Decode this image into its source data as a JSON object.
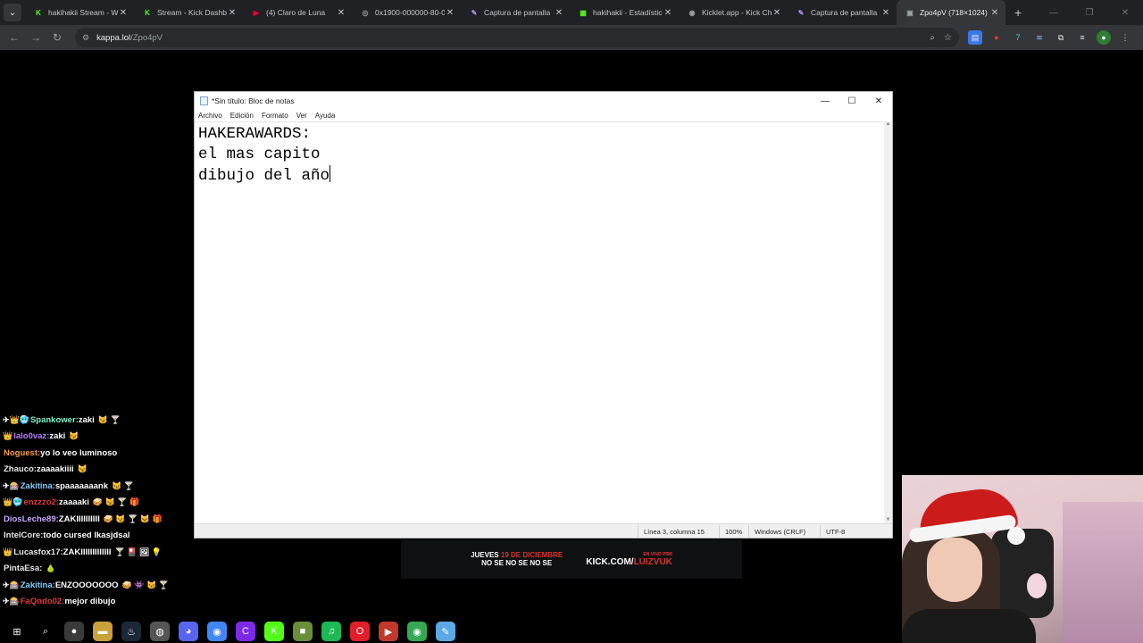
{
  "browser": {
    "tabs": [
      {
        "title": "hakihakii Stream - W",
        "favicon": "kick-icon",
        "color": "#53fc18",
        "glyph": "K"
      },
      {
        "title": "Stream - Kick Dashbo",
        "favicon": "kick-icon",
        "color": "#53fc18",
        "glyph": "K"
      },
      {
        "title": "(4) Claro de Luna",
        "favicon": "youtube-icon",
        "color": "#ff0033",
        "glyph": "▶"
      },
      {
        "title": "0x1900-000000-80-0",
        "favicon": "globe-icon",
        "color": "#9aa0a6",
        "glyph": "◎"
      },
      {
        "title": "Captura de pantalla",
        "favicon": "pen-icon",
        "color": "#b58cff",
        "glyph": "✎"
      },
      {
        "title": "hakihakii - Estadístic",
        "favicon": "stats-icon",
        "color": "#53fc18",
        "glyph": "▦"
      },
      {
        "title": "Kicklet.app - Kick Ch",
        "favicon": "kicklet-icon",
        "color": "#9aa0a6",
        "glyph": "◉"
      },
      {
        "title": "Captura de pantalla",
        "favicon": "pen-icon",
        "color": "#b58cff",
        "glyph": "✎"
      },
      {
        "title": "Zpo4pV (718×1024)",
        "favicon": "image-icon",
        "color": "#9aa0a6",
        "glyph": "▣",
        "active": true
      }
    ],
    "new_tab": "+",
    "url_host": "kappa.lol",
    "url_path": "/Zpo4pV"
  },
  "notepad": {
    "title": "*Sin título: Bloc de notas",
    "menu": [
      "Archivo",
      "Edición",
      "Formato",
      "Ver",
      "Ayuda"
    ],
    "lines": [
      "HAKERAWARDS:",
      "el mas capito",
      "dibujo del año"
    ],
    "status": {
      "position": "Línea 3, columna 15",
      "zoom": "100%",
      "line_ending": "Windows (CRLF)",
      "encoding": "UTF-8"
    }
  },
  "banner": {
    "line1_a": "JUEVES",
    "line1_b": "19 DE DICIEMBRE",
    "line2": "NO SE NO SE NO SE",
    "tag": "EN VIVO POR",
    "link_a": "KICK.COM/",
    "link_b": "LUIZVUK"
  },
  "chat": [
    {
      "badges": "✈👑🥶",
      "user": "Spankower",
      "color": "#7ff0c9",
      "msg": "zaki",
      "emotes": "😼 🍸"
    },
    {
      "badges": "👑",
      "user": "lalo0vaz",
      "color": "#b57cff",
      "msg": "zaki",
      "emotes": "😼"
    },
    {
      "badges": "",
      "user": "Noguest",
      "color": "#ff9b3d",
      "msg": "yo lo veo luminoso",
      "emotes": ""
    },
    {
      "badges": "",
      "user": "Zhauco",
      "color": "#e8e8e8",
      "msg": "zaaaakiiii",
      "emotes": "😼"
    },
    {
      "badges": "✈🎰",
      "user": "Zakitina",
      "color": "#7fd0ff",
      "msg": "spaaaaaaank",
      "emotes": "😼 🍸"
    },
    {
      "badges": "👑🥶",
      "user": "enzzzo2",
      "color": "#e23b3b",
      "msg": "zaaaaki",
      "emotes": "🥪 😼 🍸 🎁"
    },
    {
      "badges": "",
      "user": "DiosLeche89",
      "color": "#c9a7ff",
      "msg": "ZAKIIIIIIIIII",
      "emotes": "🥪 😼 🍸 🐱 🎁"
    },
    {
      "badges": "",
      "user": "IntelCore",
      "color": "#e8e8e8",
      "msg": "todo cursed lkasjdsal",
      "emotes": ""
    },
    {
      "badges": "👑",
      "user": "Lucasfox17",
      "color": "#e8e8e8",
      "msg": "ZAKIIIIIIIIIIIII",
      "emotes": "🍸 🎴 🖼 💡"
    },
    {
      "badges": "",
      "user": "PintaEsa",
      "color": "#e8e8e8",
      "msg": "",
      "emotes": "🍐"
    },
    {
      "badges": "✈🎰",
      "user": "Zakitina",
      "color": "#7fd0ff",
      "msg": "ENZOOOOOOO",
      "emotes": "🥪 👾 😼 🍸"
    },
    {
      "badges": "✈🎰",
      "user": "FaQndo02",
      "color": "#e23b3b",
      "msg": "mejor dibujo",
      "emotes": ""
    }
  ],
  "taskbar": [
    {
      "name": "start-icon",
      "glyph": "⊞",
      "bg": "transparent"
    },
    {
      "name": "search-icon",
      "glyph": "⌕",
      "bg": "transparent"
    },
    {
      "name": "obs-icon",
      "glyph": "●",
      "bg": "#3a3a3a"
    },
    {
      "name": "explorer-icon",
      "glyph": "▬",
      "bg": "#c9a13a"
    },
    {
      "name": "steam-icon",
      "glyph": "♨",
      "bg": "#1b2838"
    },
    {
      "name": "browser-icon",
      "glyph": "◍",
      "bg": "#555"
    },
    {
      "name": "discord-icon",
      "glyph": "◕",
      "bg": "#5865f2"
    },
    {
      "name": "chrome-icon",
      "glyph": "◉",
      "bg": "#4285f4"
    },
    {
      "name": "canva-icon",
      "glyph": "C",
      "bg": "#7d2ae8"
    },
    {
      "name": "kick-icon",
      "glyph": "K",
      "bg": "#53fc18"
    },
    {
      "name": "minecraft-icon",
      "glyph": "■",
      "bg": "#6b8e3a"
    },
    {
      "name": "spotify-icon",
      "glyph": "♫",
      "bg": "#1db954"
    },
    {
      "name": "opera-icon",
      "glyph": "O",
      "bg": "#e01f2c"
    },
    {
      "name": "video-icon",
      "glyph": "▶",
      "bg": "#c0392b"
    },
    {
      "name": "chrome-alt-icon",
      "glyph": "◉",
      "bg": "#34a853"
    },
    {
      "name": "notepad-icon",
      "glyph": "✎",
      "bg": "#5aa9e6"
    }
  ]
}
